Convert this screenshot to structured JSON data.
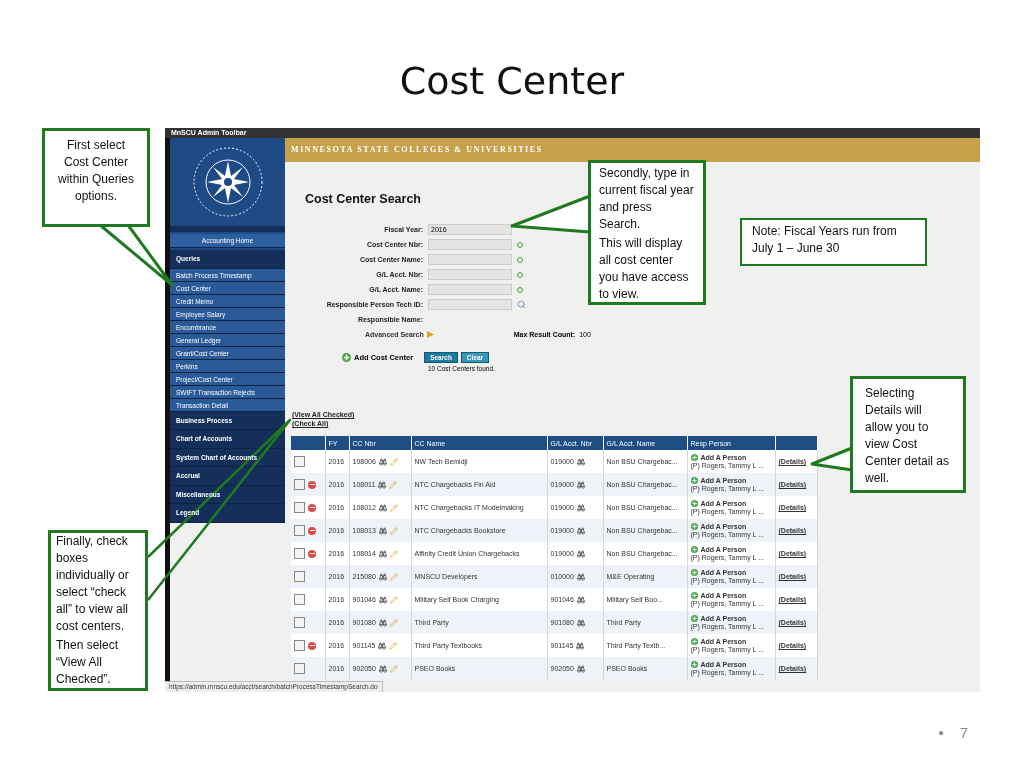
{
  "slide": {
    "title": "Cost Center",
    "bullet": "•",
    "page_number": "7"
  },
  "callouts": [
    {
      "kind": "filled",
      "paragraphs": [
        "First select Cost Center within Queries options."
      ]
    },
    {
      "kind": "filled",
      "paragraphs": [
        "Secondly, type in current fiscal year and press Search.",
        "This will display all cost center you have access to view."
      ]
    },
    {
      "kind": "plain",
      "paragraphs": [
        "Note: Fiscal Years run from July 1 – June 30"
      ]
    },
    {
      "kind": "filled",
      "paragraphs": [
        "Selecting Details will allow you to view Cost Center detail as well."
      ]
    },
    {
      "kind": "outline",
      "paragraphs": [
        "Finally, check boxes individually or select “check all” to view all cost centers.",
        "Then select “View All Checked”."
      ]
    }
  ],
  "browser": {
    "toolbar_title": "MnSCU Admin Toolbar",
    "status_url": "https://admin.mnscu.edu/acct/search/batchProcessTimestampSearch.do"
  },
  "banner": "MINNESOTA STATE COLLEGES & UNIVERSITIES",
  "sidebar": {
    "items": [
      {
        "label": "Accounting Home",
        "kind": "home"
      },
      {
        "label": "Queries",
        "kind": "section"
      },
      {
        "label": "Batch Process Timestamp",
        "kind": "link"
      },
      {
        "label": "Cost Center",
        "kind": "link"
      },
      {
        "label": "Credit Memo",
        "kind": "link"
      },
      {
        "label": "Employee Salary",
        "kind": "link"
      },
      {
        "label": "Encumbrance",
        "kind": "link"
      },
      {
        "label": "General Ledger",
        "kind": "link"
      },
      {
        "label": "Grant/Cost Center",
        "kind": "link"
      },
      {
        "label": "Perkins",
        "kind": "link"
      },
      {
        "label": "Project/Cost Center",
        "kind": "link"
      },
      {
        "label": "SWIFT Transaction Rejects",
        "kind": "link"
      },
      {
        "label": "Transaction Detail",
        "kind": "link"
      },
      {
        "label": "Business Process",
        "kind": "section"
      },
      {
        "label": "Chart of Accounts",
        "kind": "section"
      },
      {
        "label": "System Chart of Accounts",
        "kind": "section"
      },
      {
        "label": "Accrual",
        "kind": "section"
      },
      {
        "label": "Miscellaneous",
        "kind": "section"
      },
      {
        "label": "Legend",
        "kind": "section"
      }
    ]
  },
  "search": {
    "heading": "Cost Center Search",
    "fields": [
      {
        "label": "Fiscal Year:",
        "kind": "input",
        "value": "2016"
      },
      {
        "label": "Cost Center Nbr:",
        "kind": "go"
      },
      {
        "label": "Cost Center Name:",
        "kind": "go"
      },
      {
        "label": "G/L Acct. Nbr:",
        "kind": "go"
      },
      {
        "label": "G/L Acct. Name:",
        "kind": "go"
      },
      {
        "label": "Responsible Person Tech ID:",
        "kind": "lookup"
      },
      {
        "label": "Responsible Name:",
        "kind": "text"
      }
    ],
    "advanced": "Advanced Search",
    "max_label": "Max Result Count:",
    "max_value": "100",
    "add_label": "Add Cost Center",
    "buttons": [
      "Search",
      "Clear"
    ],
    "result": "10 Cost Centers found."
  },
  "links": [
    "(View All Checked)",
    "(Check All)"
  ],
  "table": {
    "columns": [
      "FY",
      "CC Nbr",
      "CC Name",
      "G/L Acct. Nbr",
      "G/L Acct. Name",
      "Resp Person"
    ],
    "rows": [
      {
        "checked": false,
        "removable": false,
        "fy": "2016",
        "cc_nbr": "108006",
        "cc_name": "NW Tech Bemidji",
        "gl_nbr": "019000",
        "gl_name": "Non BSU Chargebac...",
        "add_person": "Add A Person",
        "resp_person": "(P) Rogers, Tammy L ...",
        "details": "(Details)"
      },
      {
        "checked": false,
        "removable": true,
        "fy": "2016",
        "cc_nbr": "108011",
        "cc_name": "NTC Chargebacks Fin Aid",
        "gl_nbr": "019000",
        "gl_name": "Non BSU Chargebac...",
        "add_person": "Add A Person",
        "resp_person": "(P) Rogers, Tammy L ...",
        "details": "(Details)"
      },
      {
        "checked": false,
        "removable": true,
        "fy": "2016",
        "cc_nbr": "108012",
        "cc_name": "NTC Chargebacks IT Modelmaking",
        "gl_nbr": "019000",
        "gl_name": "Non BSU Chargebac...",
        "add_person": "Add A Person",
        "resp_person": "(P) Rogers, Tammy L ...",
        "details": "(Details)"
      },
      {
        "checked": false,
        "removable": true,
        "fy": "2016",
        "cc_nbr": "108013",
        "cc_name": "NTC Chargebacks Bookstore",
        "gl_nbr": "019000",
        "gl_name": "Non BSU Chargebac...",
        "add_person": "Add A Person",
        "resp_person": "(P) Rogers, Tammy L ...",
        "details": "(Details)"
      },
      {
        "checked": false,
        "removable": true,
        "fy": "2016",
        "cc_nbr": "108014",
        "cc_name": "Affinity Credit Union Chargebacks",
        "gl_nbr": "019000",
        "gl_name": "Non BSU Chargebac...",
        "add_person": "Add A Person",
        "resp_person": "(P) Rogers, Tammy L ...",
        "details": "(Details)"
      },
      {
        "checked": false,
        "removable": false,
        "fy": "2016",
        "cc_nbr": "215080",
        "cc_name": "MNSCU Developers",
        "gl_nbr": "010000",
        "gl_name": "M&E Operating",
        "add_person": "Add A Person",
        "resp_person": "(P) Rogers, Tammy L ...",
        "details": "(Details)"
      },
      {
        "checked": false,
        "removable": false,
        "fy": "2016",
        "cc_nbr": "901046",
        "cc_name": "Military Self Book Charging",
        "gl_nbr": "901046",
        "gl_name": "Military Self Boo...",
        "add_person": "Add A Person",
        "resp_person": "(P) Rogers, Tammy L ...",
        "details": "(Details)"
      },
      {
        "checked": false,
        "removable": false,
        "fy": "2016",
        "cc_nbr": "901080",
        "cc_name": "Third Party",
        "gl_nbr": "901080",
        "gl_name": "Third Party",
        "add_person": "Add A Person",
        "resp_person": "(P) Rogers, Tammy L ...",
        "details": "(Details)"
      },
      {
        "checked": false,
        "removable": true,
        "fy": "2016",
        "cc_nbr": "901145",
        "cc_name": "Third Party Textbooks",
        "gl_nbr": "901145",
        "gl_name": "Third Party Textb...",
        "add_person": "Add A Person",
        "resp_person": "(P) Rogers, Tammy L ...",
        "details": "(Details)"
      },
      {
        "checked": false,
        "removable": false,
        "fy": "2016",
        "cc_nbr": "902050",
        "cc_name": "PSEO Books",
        "gl_nbr": "902050",
        "gl_name": "PSEO Books",
        "add_person": "Add A Person",
        "resp_person": "(P) Rogers, Tammy L ...",
        "details": "(Details)"
      }
    ]
  }
}
